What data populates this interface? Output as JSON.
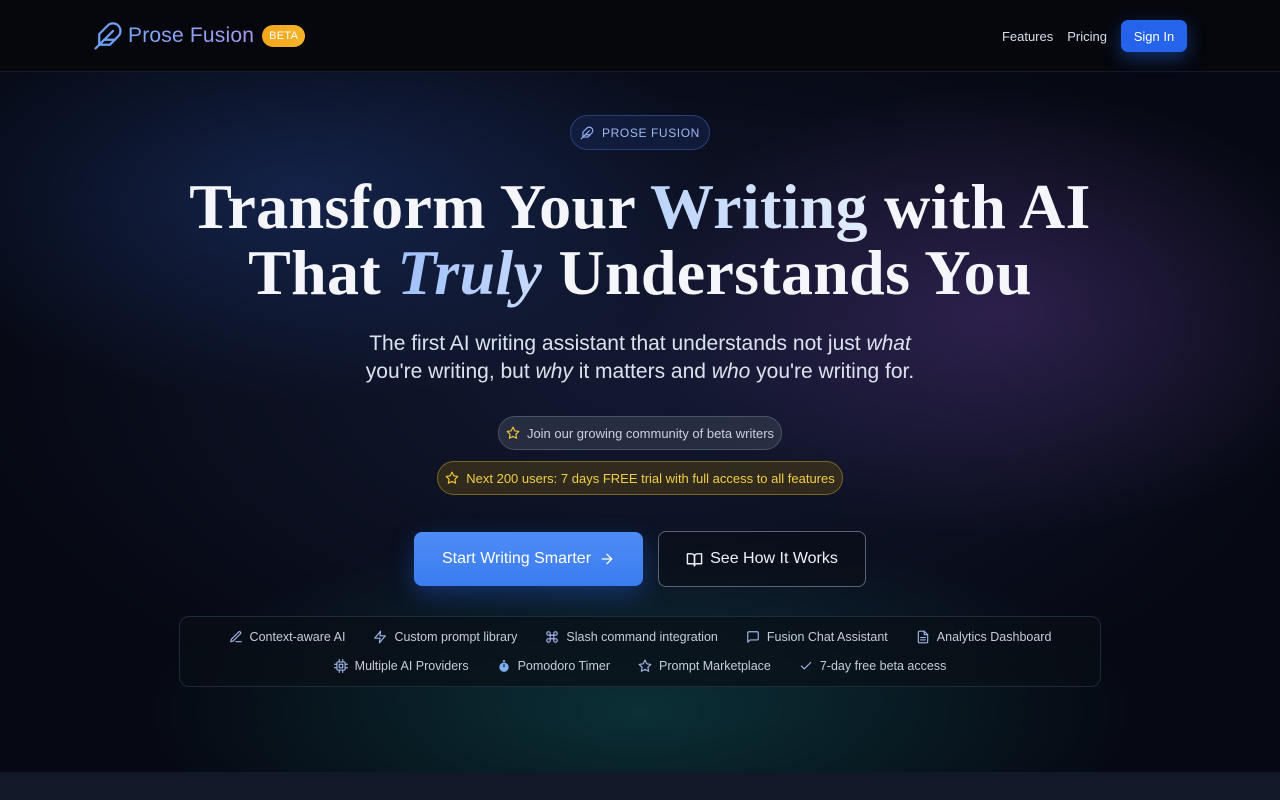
{
  "header": {
    "brand_name": "Prose Fusion",
    "beta_badge": "BETA",
    "nav": {
      "features": "Features",
      "pricing": "Pricing",
      "sign_in": "Sign In"
    }
  },
  "hero": {
    "eyebrow": "PROSE FUSION",
    "headline": {
      "line1_part1": "Transform Your ",
      "line1_highlight": "Writing",
      "line1_part2": " with AI",
      "line2_part1": "That ",
      "line2_italic": "Truly",
      "line2_part2": " Understands You"
    },
    "subtitle": {
      "part1": "The first AI writing assistant that understands not just ",
      "em1": "what",
      "part2": "you're writing, but ",
      "em2": "why",
      "part3": " it matters and ",
      "em3": "who",
      "part4": " you're writing for."
    },
    "community_badge": "Join our growing community of beta writers",
    "trial_badge": "Next 200 users: 7 days FREE trial with full access to all features",
    "primary_button": "Start Writing Smarter",
    "secondary_button": "See How It Works"
  },
  "features": {
    "row1": [
      {
        "label": "Context-aware AI",
        "icon": "pen-icon"
      },
      {
        "label": "Custom prompt library",
        "icon": "bolt-icon"
      },
      {
        "label": "Slash command integration",
        "icon": "command-icon"
      },
      {
        "label": "Fusion Chat Assistant",
        "icon": "chat-icon"
      },
      {
        "label": "Analytics Dashboard",
        "icon": "document-icon"
      }
    ],
    "row2": [
      {
        "label": "Multiple AI Providers",
        "icon": "cpu-icon"
      },
      {
        "label": "Pomodoro Timer",
        "icon": "timer-icon"
      },
      {
        "label": "Prompt Marketplace",
        "icon": "star-icon"
      },
      {
        "label": "7-day free beta access",
        "icon": "check-icon"
      }
    ]
  },
  "colors": {
    "accent": "#2563eb",
    "primary_button": "#3b7cf0",
    "beta_badge": "#f3a51b",
    "trial_text": "#f2cd4a"
  }
}
